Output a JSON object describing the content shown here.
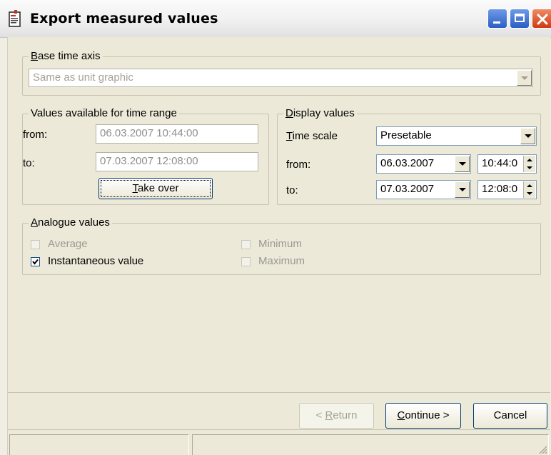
{
  "window": {
    "title": "Export measured values",
    "icon": "app-document-icon"
  },
  "base_time_axis": {
    "legend_prefix": "",
    "legend_underlined": "B",
    "legend_rest": "ase time axis",
    "selected": "Same as unit graphic"
  },
  "values_available": {
    "legend": "Values available for time range",
    "from_label": "from:",
    "from_value": "06.03.2007  10:44:00",
    "to_label": "to:",
    "to_value": "07.03.2007  12:08:00",
    "take_over_underlined": "T",
    "take_over_rest": "ake over"
  },
  "display_values": {
    "legend_underlined": "D",
    "legend_rest": "isplay values",
    "time_scale_underlined": "T",
    "time_scale_rest": "ime scale",
    "time_scale_value": "Presetable",
    "from_label": "from:",
    "from_date": "06.03.2007",
    "from_time": "10:44:0",
    "to_label": "to:",
    "to_date": "07.03.2007",
    "to_time": "12:08:0"
  },
  "analogue_values": {
    "legend_underlined": "A",
    "legend_rest": "nalogue values",
    "options": [
      {
        "label": "Average",
        "checked": false,
        "enabled": false
      },
      {
        "label": "Instantaneous value",
        "checked": true,
        "enabled": true
      },
      {
        "label": "Minimum",
        "checked": false,
        "enabled": false
      },
      {
        "label": "Maximum",
        "checked": false,
        "enabled": false
      }
    ]
  },
  "footer": {
    "return_prefix": "< ",
    "return_underlined": "R",
    "return_rest": "eturn",
    "continue_underlined": "C",
    "continue_rest": "ontinue >",
    "cancel_label": "Cancel"
  },
  "colors": {
    "dialog_bg": "#ece9d8",
    "titlebar_close": "#cf3a12",
    "titlebar_buttons": "#2a5ec4",
    "field_border": "#7f9db9"
  }
}
